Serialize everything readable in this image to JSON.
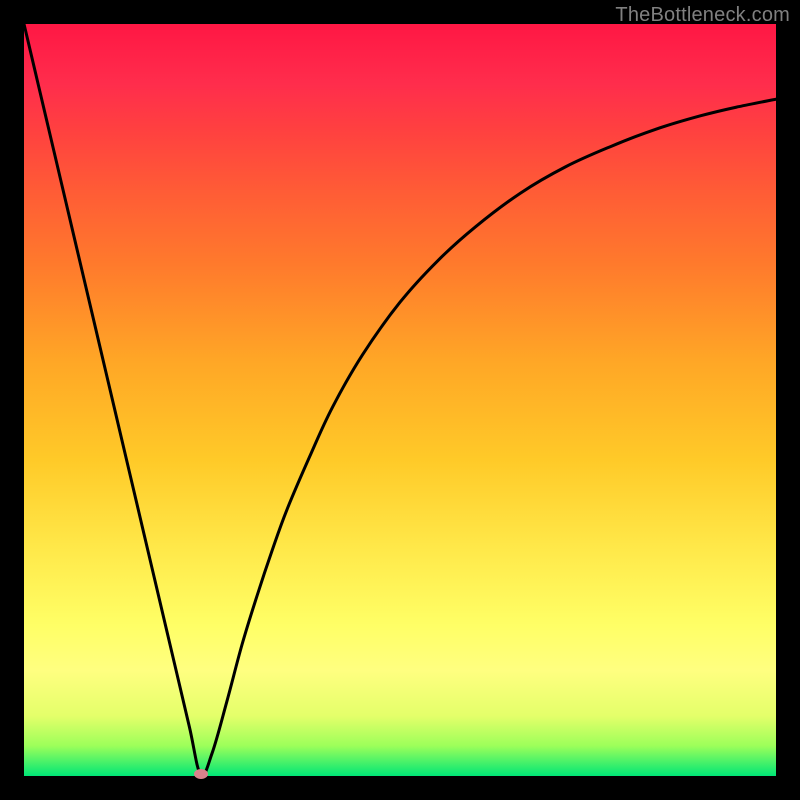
{
  "watermark": "TheBottleneck.com",
  "colors": {
    "background": "#000000",
    "curve_stroke": "#000000",
    "marker_fill": "#d9818c",
    "watermark_text": "#808080"
  },
  "chart_data": {
    "type": "line",
    "title": "",
    "xlabel": "",
    "ylabel": "",
    "xlim": [
      0,
      100
    ],
    "ylim": [
      0,
      100
    ],
    "x": [
      0,
      2,
      4,
      6,
      8,
      10,
      12,
      14,
      16,
      18,
      20,
      22,
      23.5,
      25,
      27,
      29,
      31,
      33,
      35,
      38,
      41,
      45,
      50,
      55,
      60,
      66,
      72,
      78,
      84,
      90,
      95,
      100
    ],
    "y": [
      100,
      91.5,
      83.0,
      74.5,
      66.0,
      57.5,
      49.0,
      40.5,
      32.0,
      23.5,
      15.0,
      6.5,
      0.2,
      3.0,
      10.0,
      17.5,
      24.0,
      30.0,
      35.5,
      42.5,
      49.0,
      56.0,
      63.0,
      68.5,
      73.0,
      77.5,
      81.0,
      83.7,
      86.0,
      87.8,
      89.0,
      90.0
    ],
    "marker": {
      "x": 23.5,
      "y": 0.2
    },
    "grid": false,
    "legend": false
  }
}
